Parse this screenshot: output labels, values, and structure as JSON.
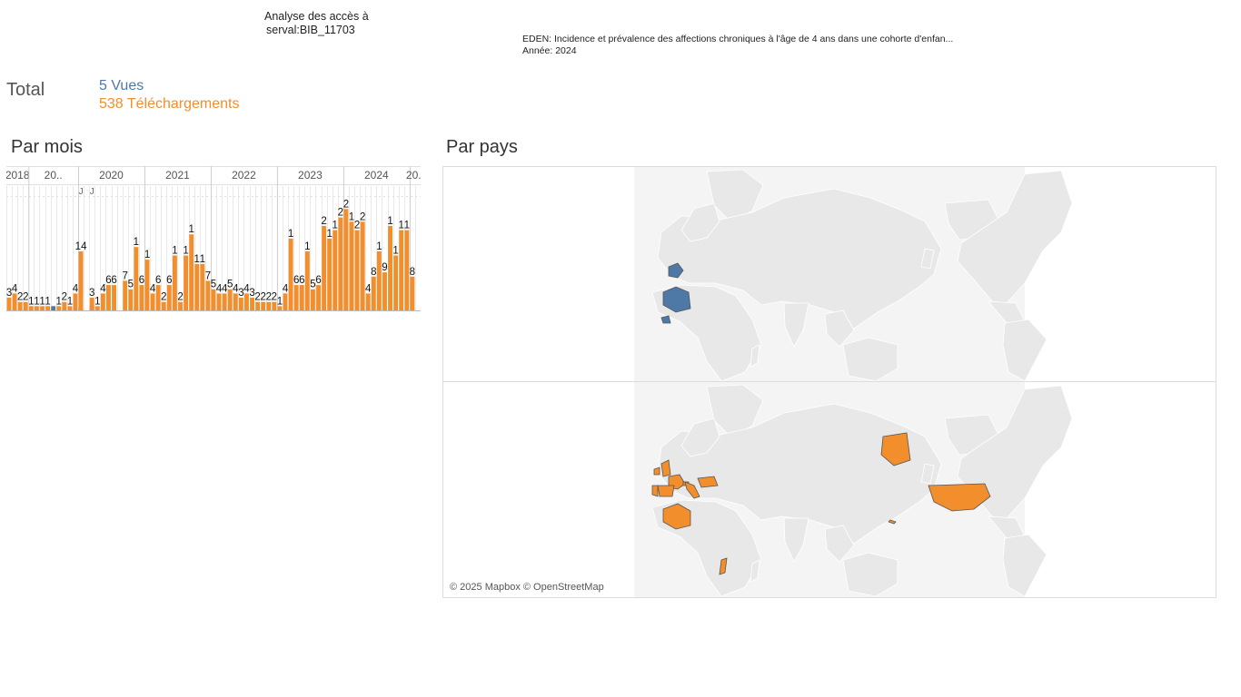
{
  "header": {
    "title_line1": "Analyse des accès à",
    "title_line2": "serval:BIB_11703",
    "doc_title": "EDEN: Incidence et prévalence des affections chroniques à l'âge de 4 ans dans une cohorte d'enfan...",
    "year_line": "Année: 2024"
  },
  "totals": {
    "label": "Total",
    "vues": "5 Vues",
    "telechargements": "538 Téléchargements"
  },
  "sections": {
    "par_mois": "Par mois",
    "par_pays": "Par pays"
  },
  "attribution": "© 2025 Mapbox © OpenStreetMap",
  "colors": {
    "vues": "#4e79a7",
    "telechargements": "#f28e2b",
    "map_land": "#e8e8e8",
    "map_border": "#ffffff"
  },
  "chart_data": {
    "type": "bar",
    "year_labels": [
      "2018",
      "20..",
      "2020",
      "2021",
      "2022",
      "2023",
      "2024",
      "20.."
    ],
    "month_labels": [
      "J",
      "J"
    ],
    "series": [
      {
        "name": "Vues",
        "values": [
          0,
          0,
          0,
          0,
          0,
          0,
          0,
          0,
          1,
          0,
          0,
          0,
          0,
          1,
          0,
          1,
          0,
          0,
          0,
          0,
          0,
          0,
          0,
          1,
          0,
          0,
          0,
          0,
          0,
          0,
          0,
          0,
          0,
          0,
          0,
          0,
          0,
          0,
          0,
          0,
          0,
          0,
          0,
          0,
          0,
          0,
          0,
          0,
          0,
          0,
          0,
          0,
          0,
          0,
          0,
          0,
          0,
          0,
          0,
          0,
          0,
          0,
          0,
          0,
          0,
          0,
          0,
          0,
          0,
          0,
          0,
          0,
          0,
          0,
          0
        ]
      },
      {
        "name": "Téléchargements",
        "values": [
          3,
          4,
          2,
          2,
          1,
          1,
          1,
          1,
          0,
          1,
          2,
          1,
          4,
          14,
          0,
          3,
          1,
          4,
          6,
          6,
          0,
          7,
          5,
          15,
          6,
          12,
          4,
          6,
          2,
          6,
          13,
          2,
          13,
          18,
          11,
          11,
          7,
          5,
          4,
          4,
          5,
          4,
          3,
          4,
          3,
          2,
          2,
          2,
          2,
          1,
          4,
          17,
          6,
          6,
          14,
          5,
          6,
          20,
          17,
          19,
          22,
          24,
          21,
          19,
          21,
          4,
          8,
          14,
          9,
          20,
          13,
          19,
          19,
          8,
          0
        ]
      }
    ],
    "labels": [
      "3",
      "4",
      "2",
      "2",
      "1",
      "1",
      "1",
      "1",
      "",
      "1",
      "2",
      "1",
      "4",
      "14",
      "",
      "3",
      "1",
      "4",
      "6",
      "6",
      "",
      "7",
      "5",
      "1",
      "6",
      "1",
      "4",
      "6",
      "2",
      "6",
      "1",
      "2",
      "1",
      "1",
      "1",
      "1",
      "7",
      "5",
      "4",
      "4",
      "5",
      "4",
      "3",
      "4",
      "3",
      "2",
      "2",
      "2",
      "2",
      "1",
      "4",
      "1",
      "6",
      "6",
      "1",
      "5",
      "6",
      "2",
      "1",
      "1",
      "2",
      "2",
      "1",
      "2",
      "2",
      "4",
      "8",
      "1",
      "9",
      "1",
      "1",
      "1",
      "1",
      "8",
      ""
    ]
  },
  "map_data": {
    "vues_countries": [
      "France",
      "Algeria",
      "Guinea"
    ],
    "telechargements_countries": [
      "United Kingdom",
      "Ireland",
      "France",
      "Spain",
      "Portugal",
      "Switzerland",
      "Italy",
      "Hungary",
      "Algeria",
      "Madagascar",
      "United States",
      "Alaska (USA)",
      "Hawaii (USA)"
    ]
  }
}
